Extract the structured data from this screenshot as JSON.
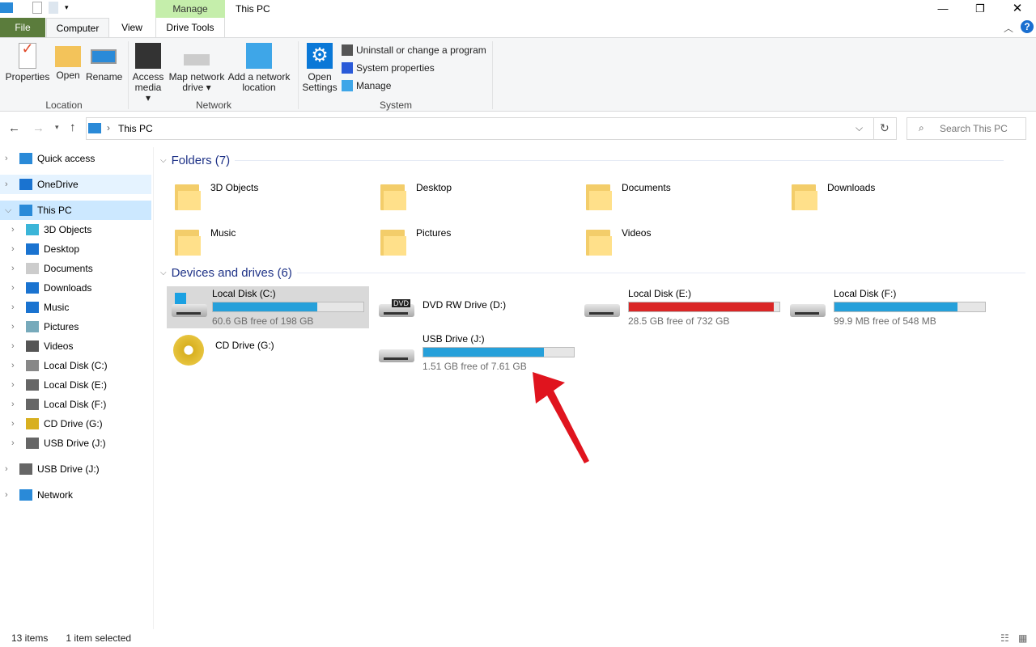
{
  "window": {
    "title": "This PC",
    "manage_tab": "Manage",
    "controls": [
      "minimize",
      "restore",
      "close"
    ]
  },
  "tabs": {
    "file": "File",
    "computer": "Computer",
    "view": "View",
    "drive_tools": "Drive Tools"
  },
  "ribbon": {
    "location": {
      "label": "Location",
      "buttons": [
        "Properties",
        "Open",
        "Rename"
      ]
    },
    "network": {
      "label": "Network",
      "access_media": [
        "Access",
        "media"
      ],
      "map_drive": [
        "Map network",
        "drive"
      ],
      "add_location": [
        "Add a network",
        "location"
      ]
    },
    "system": {
      "label": "System",
      "open_settings": [
        "Open",
        "Settings"
      ],
      "uninstall": "Uninstall or change a program",
      "system_properties": "System properties",
      "manage": "Manage"
    }
  },
  "address": {
    "path": "This PC",
    "search_placeholder": "Search This PC"
  },
  "nav": {
    "items": [
      {
        "label": "Quick access",
        "level": 0
      },
      {
        "label": "OneDrive",
        "level": 0
      },
      {
        "label": "This PC",
        "level": 0,
        "selected": true
      },
      {
        "label": "3D Objects",
        "level": 1
      },
      {
        "label": "Desktop",
        "level": 1
      },
      {
        "label": "Documents",
        "level": 1
      },
      {
        "label": "Downloads",
        "level": 1
      },
      {
        "label": "Music",
        "level": 1
      },
      {
        "label": "Pictures",
        "level": 1
      },
      {
        "label": "Videos",
        "level": 1
      },
      {
        "label": "Local Disk (C:)",
        "level": 1
      },
      {
        "label": "Local Disk (E:)",
        "level": 1
      },
      {
        "label": "Local Disk (F:)",
        "level": 1
      },
      {
        "label": "CD Drive (G:)",
        "level": 1
      },
      {
        "label": "USB Drive (J:)",
        "level": 1
      },
      {
        "label": "USB Drive (J:)",
        "level": 0
      },
      {
        "label": "Network",
        "level": 0
      }
    ]
  },
  "folders": {
    "header": "Folders (7)",
    "items": [
      "3D Objects",
      "Desktop",
      "Documents",
      "Downloads",
      "Music",
      "Pictures",
      "Videos"
    ]
  },
  "drives": {
    "header": "Devices and drives (6)",
    "items": [
      {
        "name": "Local Disk (C:)",
        "free": "60.6 GB free of 198 GB",
        "used_pct": 69.4,
        "bar_color": "#26a0da",
        "selected": true
      },
      {
        "name": "DVD RW Drive (D:)"
      },
      {
        "name": "Local Disk (E:)",
        "free": "28.5 GB free of 732 GB",
        "used_pct": 96.1,
        "bar_color": "#da2626"
      },
      {
        "name": "Local Disk (F:)",
        "free": "99.9 MB free of 548 MB",
        "used_pct": 81.8,
        "bar_color": "#26a0da"
      },
      {
        "name": "CD Drive (G:)"
      },
      {
        "name": "USB Drive (J:)",
        "free": "1.51 GB free of 7.61 GB",
        "used_pct": 80.2,
        "bar_color": "#26a0da"
      }
    ]
  },
  "status": {
    "items": "13 items",
    "selected": "1 item selected"
  },
  "annotation": {
    "arrow_color": "#e0141e"
  }
}
